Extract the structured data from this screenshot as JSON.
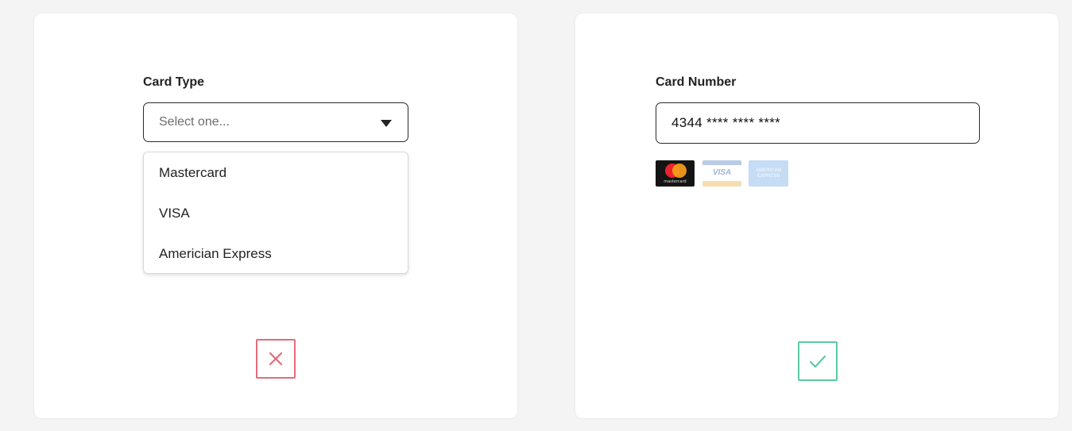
{
  "card_type_panel": {
    "label": "Card Type",
    "select": {
      "placeholder": "Select one...",
      "options": [
        "Mastercard",
        "VISA",
        "Americian Express"
      ]
    },
    "status": {
      "icon": "close-icon",
      "color": "#e36c7a"
    }
  },
  "card_number_panel": {
    "label": "Card Number",
    "input": {
      "value": "4344 **** **** ****"
    },
    "card_logos": [
      {
        "name": "mastercard-logo",
        "caption": "mastercard"
      },
      {
        "name": "visa-logo",
        "caption": "VISA"
      },
      {
        "name": "amex-logo",
        "caption": "AMERICAN EXPRESS"
      }
    ],
    "status": {
      "icon": "check-icon",
      "color": "#5ccaa0"
    }
  },
  "colors": {
    "background": "#f4f4f4",
    "panel": "#ffffff",
    "error": "#e36c7a",
    "success": "#5ccaa0"
  }
}
